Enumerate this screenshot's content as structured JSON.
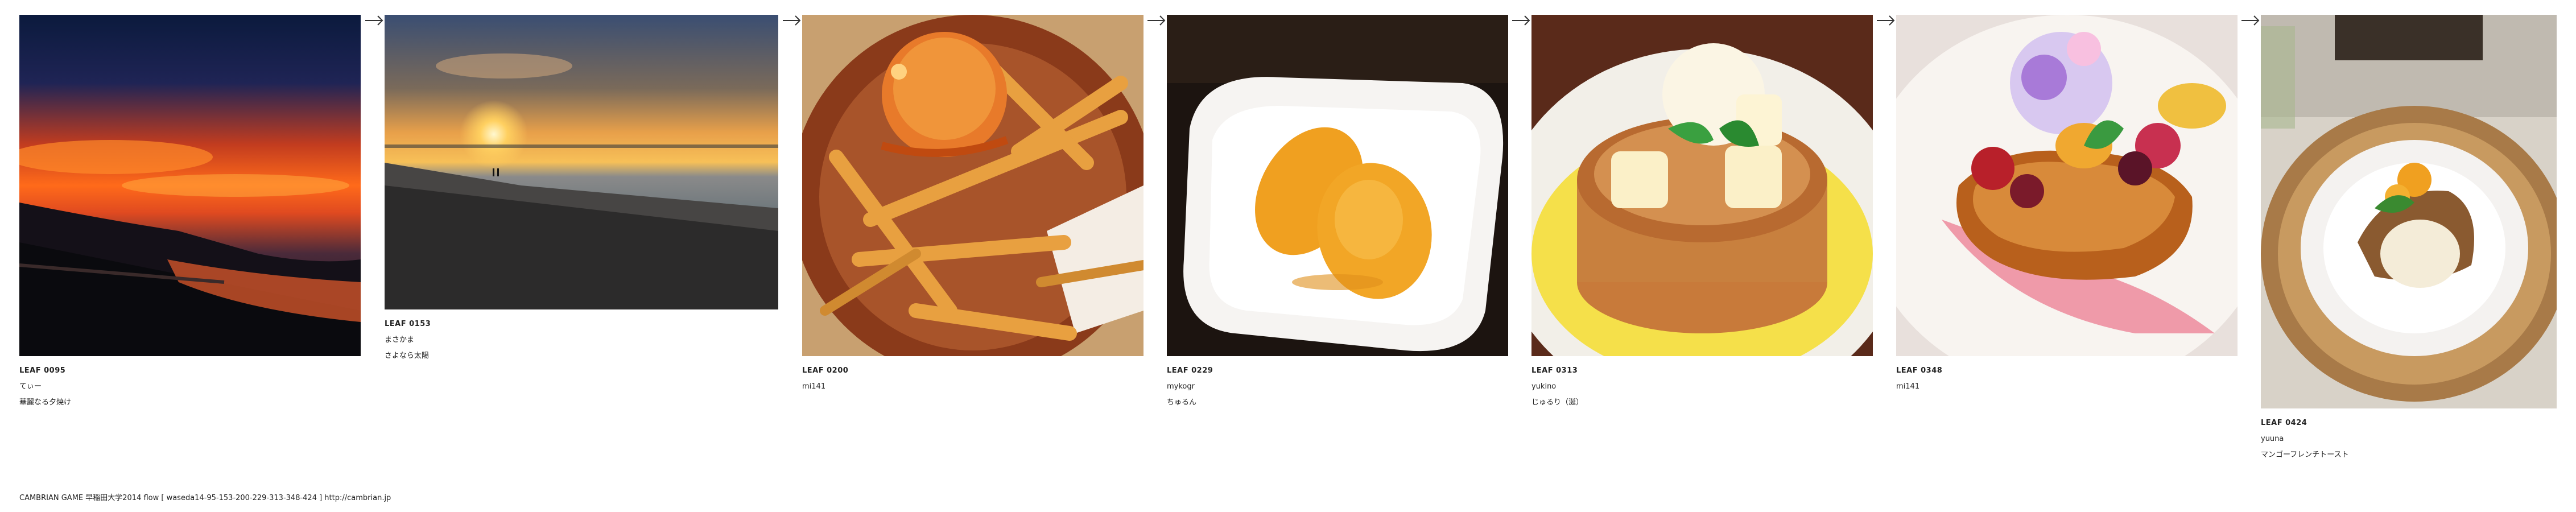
{
  "leaves": [
    {
      "id": "LEAF 0095",
      "author": "てぃー",
      "title": "華麗なる夕焼け",
      "photo": "sunset-clouds-photo"
    },
    {
      "id": "LEAF 0153",
      "author": "まさかま",
      "title": "さよなら太陽",
      "photo": "beach-sunset-photo"
    },
    {
      "id": "LEAF 0200",
      "author": "mi141",
      "title": "",
      "photo": "fries-dessert-photo"
    },
    {
      "id": "LEAF 0229",
      "author": "mykogr",
      "title": "ちゅるん",
      "photo": "mango-plate-photo"
    },
    {
      "id": "LEAF 0313",
      "author": "yukino",
      "title": "じゅるり（涎）",
      "photo": "pancake-photo"
    },
    {
      "id": "LEAF 0348",
      "author": "mi141",
      "title": "",
      "photo": "french-toast-berries-photo"
    },
    {
      "id": "LEAF 0424",
      "author": "yuuna",
      "title": "マンゴーフレンチトースト",
      "photo": "mango-french-toast-photo"
    }
  ],
  "footer": {
    "text": "CAMBRIAN GAME   早稲田大学2014   flow [ waseda14-95-153-200-229-313-348-424 ]    http://cambrian.jp"
  }
}
